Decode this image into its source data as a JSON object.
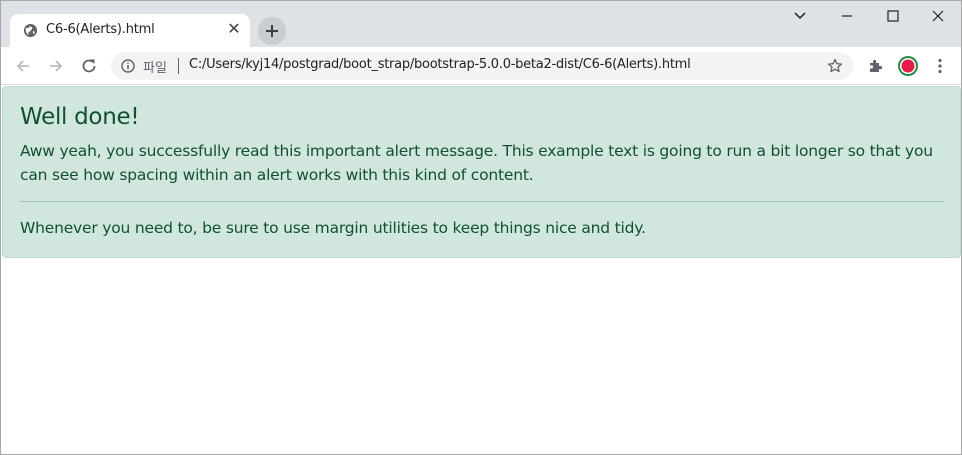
{
  "browser": {
    "tab": {
      "title": "C6-6(Alerts).html",
      "close_glyph": "✕",
      "favicon": "globe-icon"
    },
    "new_tab_glyph": "+",
    "window_controls": {
      "collapse": "chevron-down-icon",
      "minimize": "minimize-icon",
      "maximize": "maximize-icon",
      "close": "close-icon"
    },
    "omnibox": {
      "scheme_label": "파일",
      "url": "C:/Users/kyj14/postgrad/boot_strap/bootstrap-5.0.0-beta2-dist/C6-6(Alerts).html"
    },
    "profile_color": "#e8194b",
    "profile_ring": "#1e8e3e"
  },
  "alert": {
    "heading": "Well done!",
    "body": "Aww yeah, you successfully read this important alert message. This example text is going to run a bit longer so that you can see how spacing within an alert works with this kind of content.",
    "footer": "Whenever you need to, be sure to use margin utilities to keep things nice and tidy.",
    "colors": {
      "background": "#d1e7dd",
      "text": "#0f5132",
      "border": "#badbcc"
    }
  }
}
